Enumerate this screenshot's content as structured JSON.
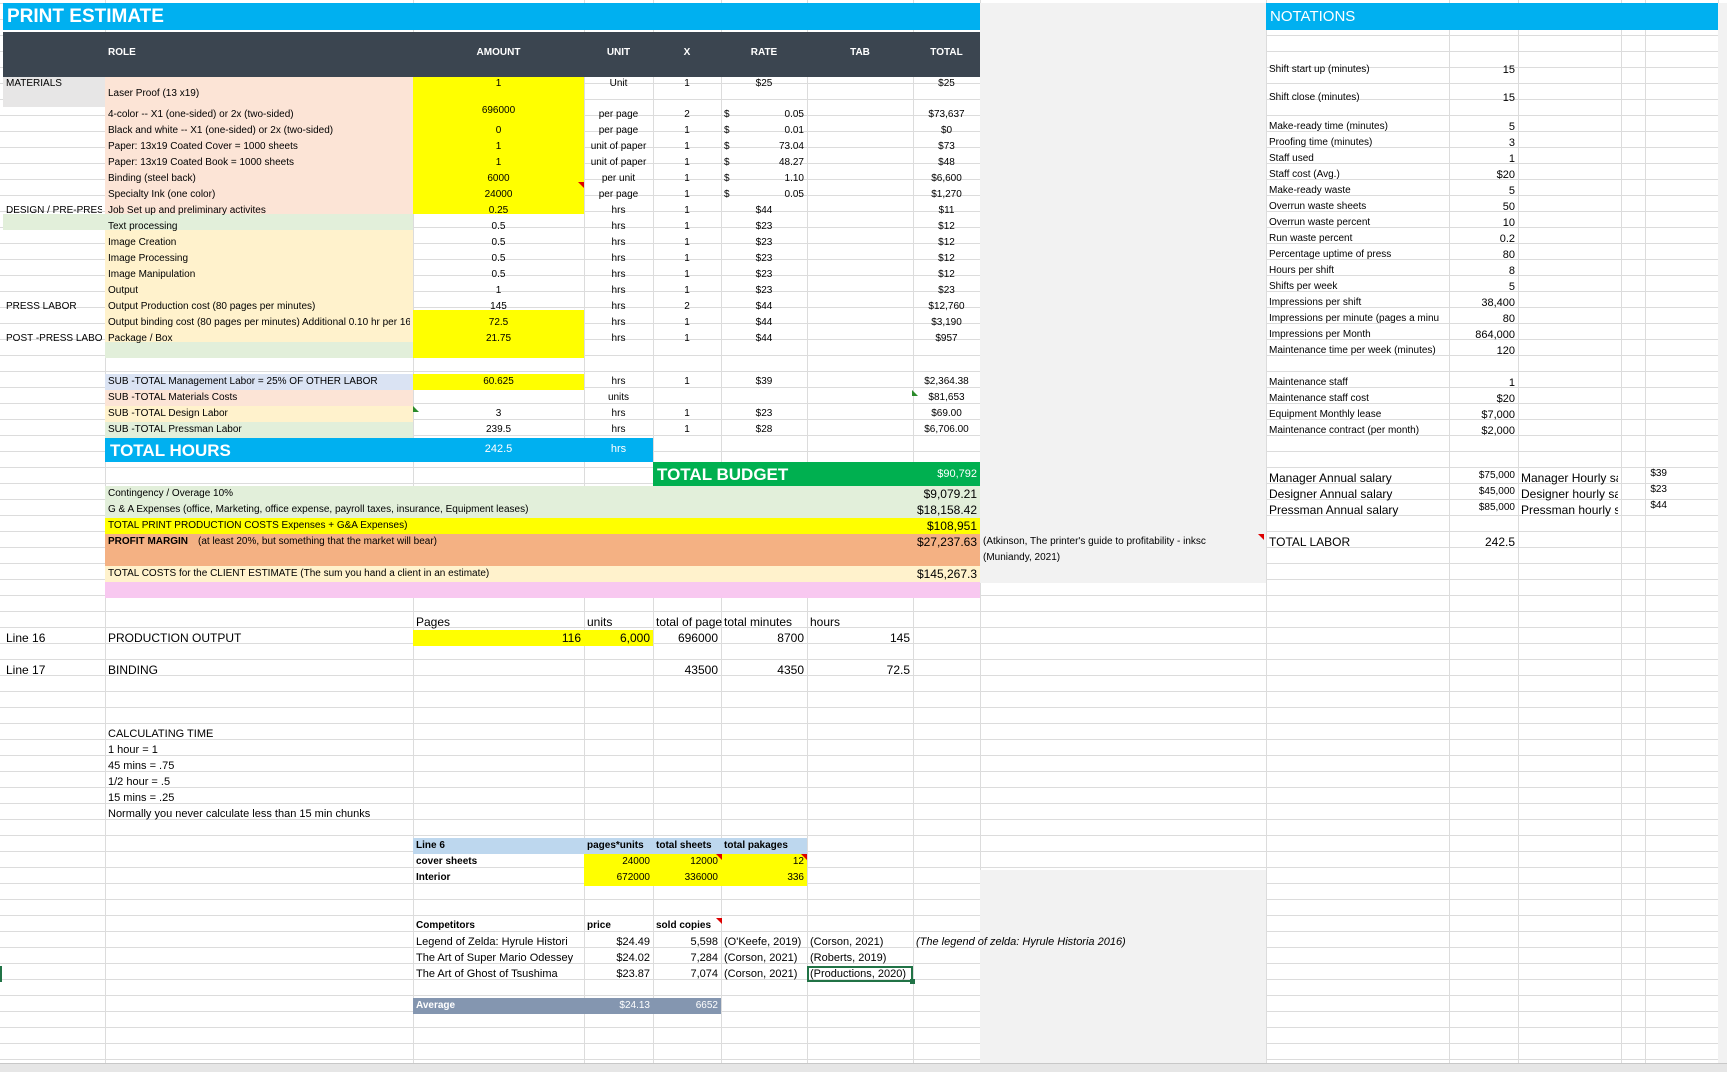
{
  "title": "PRINT ESTIMATE",
  "notations_title": "NOTATIONS",
  "headers": {
    "role": "ROLE",
    "amount": "AMOUNT",
    "unit": "UNIT",
    "x": "X",
    "rate": "RATE",
    "tab": "TAB",
    "total": "TOTAL"
  },
  "rows": [
    {
      "cat": "MATERIALS",
      "role": "Laser Proof (13 x19)",
      "amount": "1",
      "unit": "Unit",
      "x": "1",
      "dollar": "",
      "rate": "$25",
      "total": "$25"
    },
    {
      "cat": "",
      "role": "4-color -- X1 (one-sided) or 2x (two-sided)",
      "amount": "696000",
      "unit": "per page",
      "x": "2",
      "dollar": "$",
      "rate": "0.05",
      "total": "$73,637"
    },
    {
      "cat": "",
      "role": "Black and white -- X1 (one-sided) or 2x (two-sided)",
      "amount": "0",
      "unit": "per page",
      "x": "1",
      "dollar": "$",
      "rate": "0.01",
      "total": "$0"
    },
    {
      "cat": "",
      "role": "Paper: 13x19 Coated Cover = 1000 sheets",
      "amount": "1",
      "unit": "unit of paper",
      "x": "1",
      "dollar": "$",
      "rate": "73.04",
      "total": "$73"
    },
    {
      "cat": "",
      "role": "Paper: 13x19 Coated Book = 1000 sheets",
      "amount": "1",
      "unit": "unit of paper",
      "x": "1",
      "dollar": "$",
      "rate": "48.27",
      "total": "$48"
    },
    {
      "cat": "",
      "role": "Binding (steel back)",
      "amount": "6000",
      "unit": "per unit",
      "x": "1",
      "dollar": "$",
      "rate": "1.10",
      "total": "$6,600"
    },
    {
      "cat": "",
      "role": "Specialty Ink (one color)",
      "amount": "24000",
      "unit": "per page",
      "x": "1",
      "dollar": "$",
      "rate": "0.05",
      "total": "$1,270"
    },
    {
      "cat": "DESIGN / PRE-PRESS",
      "role": "Job Set up and preliminary activites",
      "amount": "0.25",
      "unit": "hrs",
      "x": "1",
      "dollar": "",
      "rate": "$44",
      "total": "$11"
    },
    {
      "cat": "",
      "role": "Text processing",
      "amount": "0.5",
      "unit": "hrs",
      "x": "1",
      "dollar": "",
      "rate": "$23",
      "total": "$12"
    },
    {
      "cat": "",
      "role": "Image Creation",
      "amount": "0.5",
      "unit": "hrs",
      "x": "1",
      "dollar": "",
      "rate": "$23",
      "total": "$12"
    },
    {
      "cat": "",
      "role": "Image Processing",
      "amount": "0.5",
      "unit": "hrs",
      "x": "1",
      "dollar": "",
      "rate": "$23",
      "total": "$12"
    },
    {
      "cat": "",
      "role": "Image Manipulation",
      "amount": "0.5",
      "unit": "hrs",
      "x": "1",
      "dollar": "",
      "rate": "$23",
      "total": "$12"
    },
    {
      "cat": "",
      "role": "Output",
      "amount": "1",
      "unit": "hrs",
      "x": "1",
      "dollar": "",
      "rate": "$23",
      "total": "$23"
    },
    {
      "cat": "PRESS LABOR",
      "role": "Output Production cost (80 pages per minutes)",
      "amount": "145",
      "unit": "hrs",
      "x": "2",
      "dollar": "",
      "rate": "$44",
      "total": "$12,760"
    },
    {
      "cat": "",
      "role": "Output binding cost (80 pages per minutes) Additional 0.10 hr per 16",
      "amount": "72.5",
      "unit": "hrs",
      "x": "1",
      "dollar": "",
      "rate": "$44",
      "total": "$3,190"
    },
    {
      "cat": "POST -PRESS LABOR",
      "role": "Package / Box",
      "amount": "21.75",
      "unit": "hrs",
      "x": "1",
      "dollar": "",
      "rate": "$44",
      "total": "$957"
    }
  ],
  "subtotals": [
    {
      "role": "SUB -TOTAL Management Labor = 25% OF OTHER LABOR",
      "amount": "60.625",
      "unit": "hrs",
      "x": "1",
      "rate": "$39",
      "total": "$2,364.38"
    },
    {
      "role": "SUB -TOTAL Materials Costs",
      "amount": "",
      "unit": "units",
      "x": "",
      "rate": "",
      "total": "$81,653"
    },
    {
      "role": "SUB -TOTAL Design Labor",
      "amount": "3",
      "unit": "hrs",
      "x": "1",
      "rate": "$23",
      "total": "$69.00"
    },
    {
      "role": "SUB -TOTAL Pressman Labor",
      "amount": "239.5",
      "unit": "hrs",
      "x": "1",
      "rate": "$28",
      "total": "$6,706.00"
    }
  ],
  "total_hours": {
    "label": "TOTAL HOURS",
    "amount": "242.5",
    "unit": "hrs"
  },
  "total_budget": {
    "label": "TOTAL BUDGET",
    "value": "$90,792"
  },
  "budget_lines": [
    {
      "label": "Contingency / Overage 10%",
      "value": "$9,079.21"
    },
    {
      "label": "G & A Expenses (office, Marketing, office expense, payroll taxes, insurance, Equipment leases)",
      "value": "$18,158.42"
    },
    {
      "label": "TOTAL PRINT PRODUCTION COSTS  Expenses + G&A Expenses)",
      "value": "$108,951"
    },
    {
      "label": "PROFIT MARGIN",
      "label_note": "(at least 20%, but something that the market will bear)",
      "value": "$27,237.63",
      "ref": "(Atkinson, The printer's guide to profitability - inksc",
      "ref2": "(Muniandy, 2021)"
    },
    {
      "label": "TOTAL COSTS for the CLIENT ESTIMATE (The sum you hand a client in an estimate)",
      "value": "$145,267.3"
    }
  ],
  "notations": [
    {
      "label": "Shift start up (minutes)",
      "value": "15"
    },
    {
      "label": "Shift close (minutes)",
      "value": "15"
    },
    {
      "label": "Make-ready time (minutes)",
      "value": "5"
    },
    {
      "label": "Proofing time (minutes)",
      "value": "3"
    },
    {
      "label": "Staff used",
      "value": "1"
    },
    {
      "label": "Staff cost (Avg.)",
      "value": "$20"
    },
    {
      "label": "Make-ready waste",
      "value": "5"
    },
    {
      "label": "Overrun waste sheets",
      "value": "50"
    },
    {
      "label": "Overrun waste percent",
      "value": "10"
    },
    {
      "label": "Run waste percent",
      "value": "0.2"
    },
    {
      "label": "Percentage uptime of press",
      "value": "80"
    },
    {
      "label": "Hours per shift",
      "value": "8"
    },
    {
      "label": "Shifts per week",
      "value": "5"
    },
    {
      "label": "Impressions per shift",
      "value": "38,400"
    },
    {
      "label": "Impressions per minute (pages a minu",
      "value": "80"
    },
    {
      "label": "Impressions per Month",
      "value": "864,000"
    },
    {
      "label": "Maintenance time per week (minutes)",
      "value": "120"
    },
    {
      "label": "Maintenance staff",
      "value": "1"
    },
    {
      "label": "Maintenance staff cost",
      "value": "$20"
    },
    {
      "label": "Equipment Monthly lease",
      "value": "$7,000"
    },
    {
      "label": "Maintenance contract (per month)",
      "value": "$2,000"
    }
  ],
  "salaries": [
    {
      "label": "Manager Annual salary",
      "value": "$75,000",
      "hourly_label": "Manager Hourly sa",
      "hourly": "$39"
    },
    {
      "label": "Designer Annual salary",
      "value": "$45,000",
      "hourly_label": "Designer hourly sa",
      "hourly": "$23"
    },
    {
      "label": "Pressman Annual salary",
      "value": "$85,000",
      "hourly_label": "Pressman hourly s",
      "hourly": "$44"
    }
  ],
  "total_labor": {
    "label": "TOTAL LABOR",
    "value": "242.5"
  },
  "production": {
    "headers": {
      "pages": "Pages",
      "units": "units",
      "total_pages": "total of page",
      "total_minutes": "total minutes",
      "hours": "hours"
    },
    "rows": [
      {
        "line": "Line 16",
        "name": "PRODUCTION OUTPUT",
        "pages": "116",
        "units": "6,000",
        "total_pages": "696000",
        "total_minutes": "8700",
        "hours": "145"
      },
      {
        "line": "Line 17",
        "name": "BINDING",
        "pages": "",
        "units": "",
        "total_pages": "43500",
        "total_minutes": "4350",
        "hours": "72.5"
      }
    ]
  },
  "calc_time": [
    "CALCULATING TIME",
    "1 hour  = 1",
    "45 mins = .75",
    "1/2 hour = .5",
    "15 mins = .25",
    "Normally you never calculate less than 15 min chunks"
  ],
  "line6": {
    "headers": {
      "name": "Line 6",
      "pu": "pages*units",
      "ts": "total sheets",
      "tp": "total pakages"
    },
    "rows": [
      {
        "name": "cover sheets",
        "pu": "24000",
        "ts": "12000",
        "tp": "12"
      },
      {
        "name": "Interior",
        "pu": "672000",
        "ts": "336000",
        "tp": "336"
      }
    ]
  },
  "competitors": {
    "headers": {
      "name": "Competitors",
      "price": "price",
      "sold": "sold copies"
    },
    "rows": [
      {
        "name": "Legend of Zelda: Hyrule Histori",
        "price": "$24.49",
        "sold": "5,598",
        "c1": "(O'Keefe, 2019)",
        "c2": "(Corson, 2021)",
        "c3": "(The legend of zelda: Hyrule Historia 2016)"
      },
      {
        "name": "The Art of Super Mario Odessey",
        "price": "$24.02",
        "sold": "7,284",
        "c1": "(Corson, 2021)",
        "c2": "(Roberts, 2019)",
        "c3": ""
      },
      {
        "name": "The Art of Ghost of Tsushima",
        "price": "$23.87",
        "sold": "7,074",
        "c1": "(Corson, 2021)",
        "c2": "(Productions, 2020)",
        "c3": ""
      }
    ],
    "average": {
      "label": "Average",
      "price": "$24.13",
      "sold": "6652"
    }
  },
  "colors": {
    "banner": "#00b0f0",
    "header": "#3b4550",
    "yellow": "#ffff00",
    "peach": "#fce4d6",
    "cream": "#fff2cc",
    "mint": "#e2efda",
    "green": "#00b050",
    "orange": "#f4b183",
    "pink": "#f8c8f0",
    "steel": "#8496b0"
  }
}
